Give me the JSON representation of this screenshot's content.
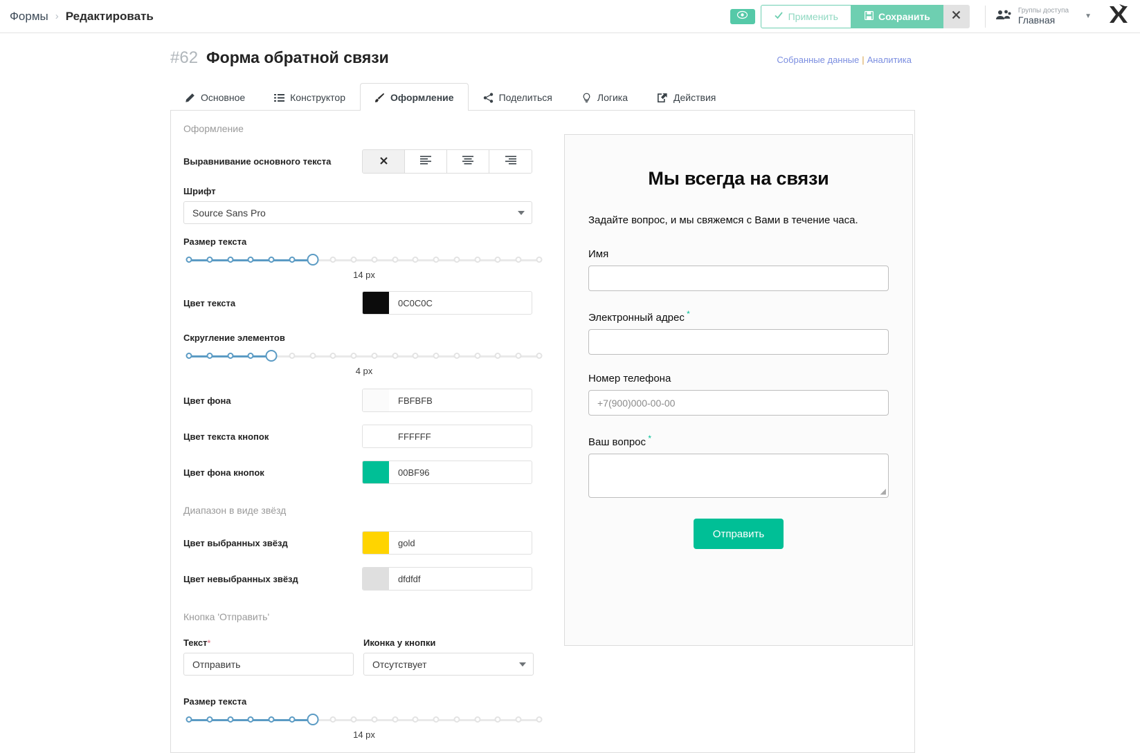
{
  "topbar": {
    "breadcrumb_root": "Формы",
    "breadcrumb_sep": "›",
    "breadcrumb_current": "Редактировать",
    "preview_icon": "eye-icon",
    "apply_label": "Применить",
    "save_label": "Сохранить",
    "close_icon": "close-icon",
    "access_caption": "Группы доступа",
    "access_value": "Главная",
    "accent_green": "#6ecfb1"
  },
  "page": {
    "form_number": "#62",
    "form_title": "Форма обратной связи",
    "link_collected": "Собранные данные",
    "link_separator": "|",
    "link_analytics": "Аналитика"
  },
  "tabs": [
    {
      "label": "Основное",
      "icon": "pencil-icon",
      "active": false
    },
    {
      "label": "Конструктор",
      "icon": "list-icon",
      "active": false
    },
    {
      "label": "Оформление",
      "icon": "brush-icon",
      "active": true
    },
    {
      "label": "Поделиться",
      "icon": "share-icon",
      "active": false
    },
    {
      "label": "Логика",
      "icon": "bulb-icon",
      "active": false
    },
    {
      "label": "Действия",
      "icon": "action-export-icon",
      "active": false
    }
  ],
  "settings": {
    "section_appearance": "Оформление",
    "align_label": "Выравнивание основного текста",
    "align_options": [
      "none",
      "left",
      "center",
      "right"
    ],
    "align_selected": "none",
    "font_label": "Шрифт",
    "font_value": "Source Sans Pro",
    "text_size_label": "Размер текста",
    "text_size_value": "14 px",
    "text_size_ticks": 18,
    "text_size_index": 6,
    "text_color_label": "Цвет текста",
    "text_color_value": "0C0C0C",
    "text_color_hex": "#0C0C0C",
    "radius_label": "Скругление элементов",
    "radius_value": "4 px",
    "radius_ticks": 18,
    "radius_index": 4,
    "bg_color_label": "Цвет фона",
    "bg_color_value": "FBFBFB",
    "bg_color_hex": "#FBFBFB",
    "btn_text_color_label": "Цвет текста кнопок",
    "btn_text_color_value": "FFFFFF",
    "btn_text_color_hex": "#FFFFFF",
    "btn_bg_color_label": "Цвет фона кнопок",
    "btn_bg_color_value": "00BF96",
    "btn_bg_color_hex": "#00BF96",
    "section_stars": "Диапазон в виде звёзд",
    "star_selected_label": "Цвет выбранных звёзд",
    "star_selected_value": "gold",
    "star_selected_hex": "#FFD400",
    "star_unselected_label": "Цвет невыбранных звёзд",
    "star_unselected_value": "dfdfdf",
    "star_unselected_hex": "#dfdfdf",
    "section_submit": "Кнопка 'Отправить'",
    "submit_text_label": "Текст",
    "submit_text_required": "*",
    "submit_text_value": "Отправить",
    "submit_icon_label": "Иконка у кнопки",
    "submit_icon_value": "Отсутствует",
    "submit_size_label": "Размер текста",
    "submit_size_value": "14 px",
    "submit_size_ticks": 18,
    "submit_size_index": 6
  },
  "preview": {
    "title": "Мы всегда на связи",
    "subtitle": "Задайте вопрос, и мы свяжемся с Вами в течение часа.",
    "fields": [
      {
        "label": "Имя",
        "required": false,
        "placeholder": "",
        "type": "input"
      },
      {
        "label": "Электронный адрес",
        "required": true,
        "placeholder": "",
        "type": "input"
      },
      {
        "label": "Номер телефона",
        "required": false,
        "placeholder": "+7(900)000-00-00",
        "type": "input"
      },
      {
        "label": "Ваш вопрос",
        "required": true,
        "placeholder": "",
        "type": "textarea"
      }
    ],
    "required_mark": "*",
    "submit_label": "Отправить",
    "submit_bg": "#00BF96"
  }
}
